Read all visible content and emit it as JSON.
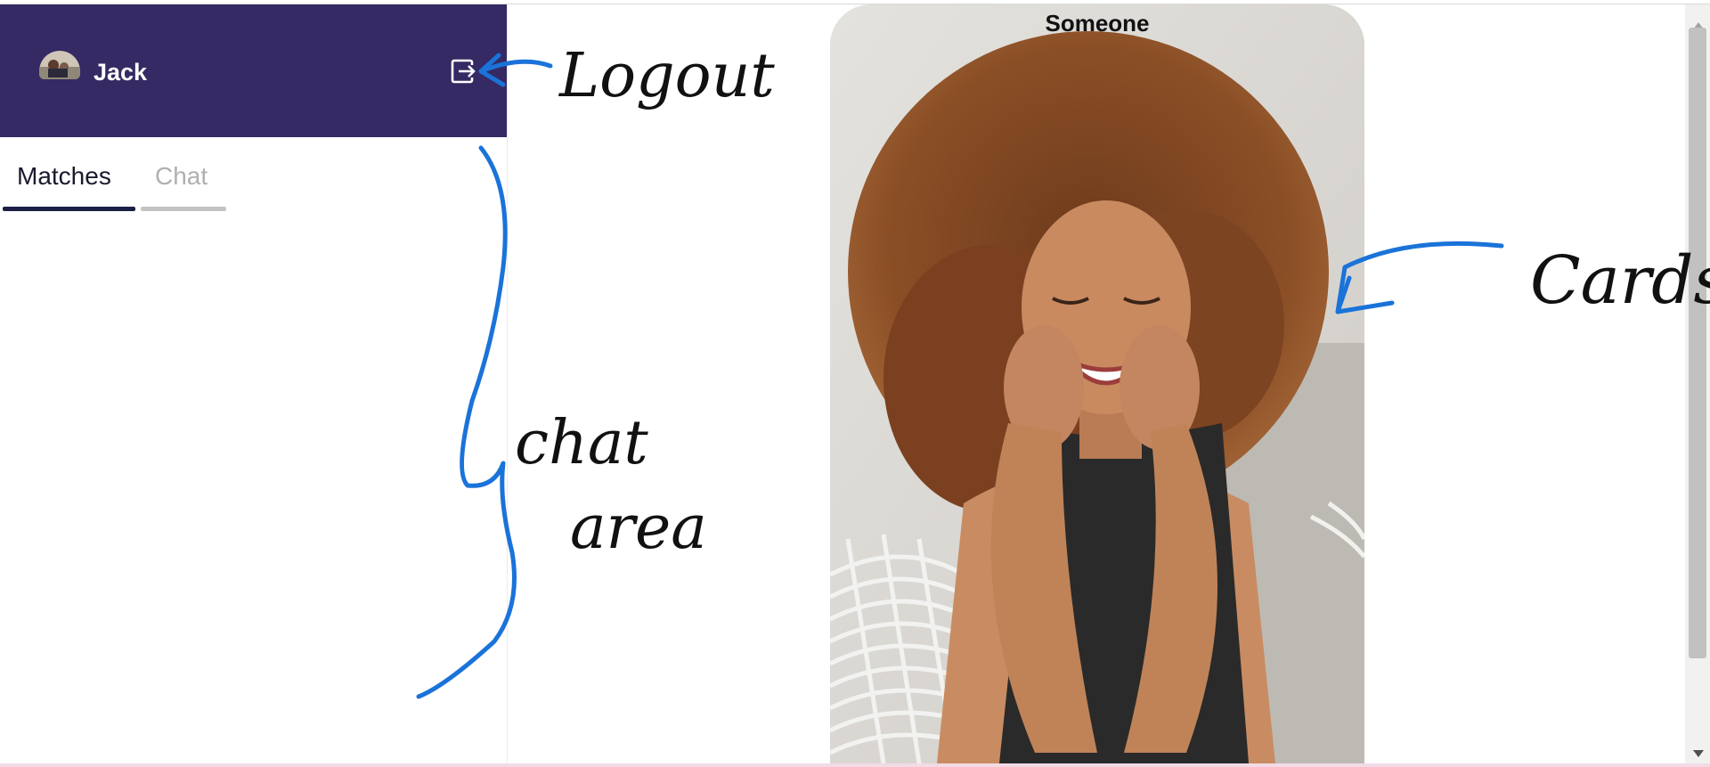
{
  "user": {
    "name": "Jack"
  },
  "tabs": [
    {
      "label": "Matches",
      "active": true
    },
    {
      "label": "Chat",
      "active": false
    }
  ],
  "card": {
    "name": "Someone"
  },
  "annotations": {
    "logout": "Logout",
    "chat_area_line1": "chat",
    "chat_area_line2": "area",
    "cards": "Cards"
  },
  "colors": {
    "header_bg": "#352a63",
    "tab_active_underline": "#1b1f45",
    "tab_inactive": "#b0b0b0",
    "annotation_blue": "#1a73d9",
    "annotation_ink": "#111111"
  },
  "icons": {
    "logout": "logout-icon",
    "avatar": "avatar"
  }
}
